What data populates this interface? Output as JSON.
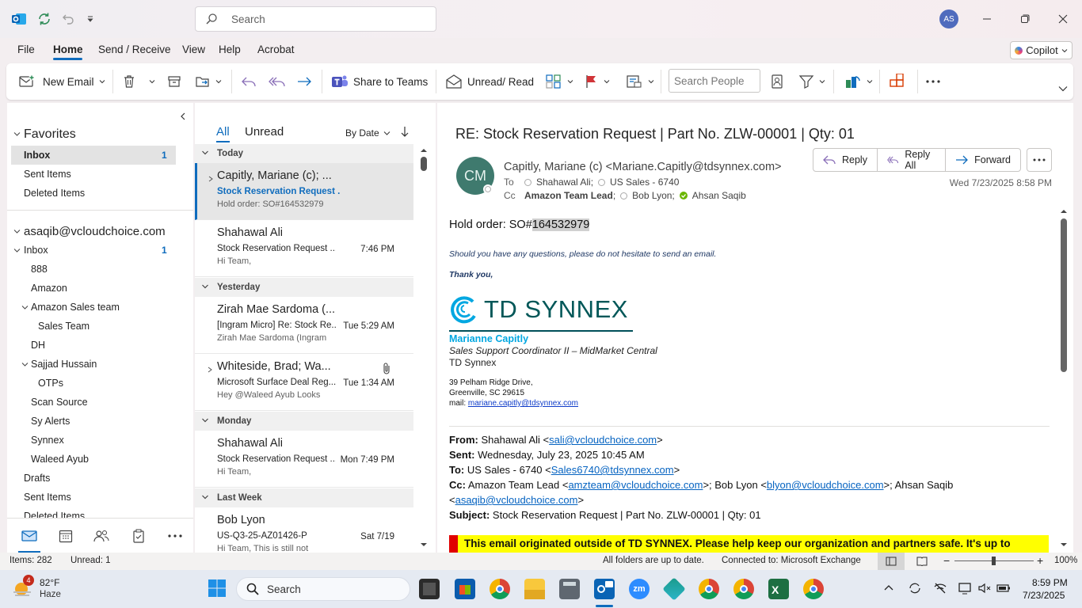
{
  "window": {
    "search_placeholder": "Search",
    "avatar_initials": "AS"
  },
  "menu": {
    "file": "File",
    "home": "Home",
    "send_receive": "Send / Receive",
    "view": "View",
    "help": "Help",
    "acrobat": "Acrobat",
    "copilot": "Copilot"
  },
  "ribbon": {
    "new_email": "New Email",
    "share_to_teams": "Share to Teams",
    "unread_read": "Unread/ Read",
    "search_people_placeholder": "Search People"
  },
  "nav": {
    "favorites": "Favorites",
    "fav_inbox": "Inbox",
    "fav_inbox_count": "1",
    "fav_sent": "Sent Items",
    "fav_deleted": "Deleted Items",
    "account": "asaqib@vcloudchoice.com",
    "inbox": "Inbox",
    "inbox_count": "1",
    "folders": [
      "888",
      "Amazon",
      "Amazon Sales team",
      "Sales Team",
      "DH",
      "Sajjad Hussain",
      "OTPs",
      "Scan Source",
      "Sy Alerts",
      "Synnex",
      "Waleed Ayub",
      "Drafts",
      "Sent Items",
      "Deleted Items"
    ]
  },
  "list": {
    "tab_all": "All",
    "tab_unread": "Unread",
    "sort": "By Date",
    "groups": {
      "today": "Today",
      "yesterday": "Yesterday",
      "monday": "Monday",
      "last_week": "Last Week"
    },
    "messages": [
      {
        "sender": "Capitly, Mariane (c); ...",
        "subject": "Stock Reservation Request ...",
        "time": "",
        "preview": "Hold order: SO#164532979"
      },
      {
        "sender": "Shahawal Ali",
        "subject": "Stock Reservation Request ...",
        "time": "7:46 PM",
        "preview": "Hi Team,"
      },
      {
        "sender": "Zirah Mae Sardoma (...",
        "subject": "[Ingram Micro] Re: Stock Re...",
        "time": "Tue 5:29 AM",
        "preview": "Zirah Mae Sardoma (Ingram"
      },
      {
        "sender": "Whiteside, Brad;  Wa...",
        "subject": "Microsoft Surface Deal Reg...",
        "time": "Tue 1:34 AM",
        "preview": "Hey @Waleed Ayub  Looks"
      },
      {
        "sender": "Shahawal Ali",
        "subject": "Stock Reservation Request ...",
        "time": "Mon 7:49 PM",
        "preview": "Hi Team,"
      },
      {
        "sender": "Bob Lyon",
        "subject": "US-Q3-25-AZ01426-P",
        "time": "Sat 7/19",
        "preview": "Hi Team,  This is still not"
      }
    ]
  },
  "email": {
    "subject": "RE: Stock Reservation Request | Part No. ZLW-00001 | Qty: 01",
    "sender_initials": "CM",
    "from": "Capitly, Mariane (c) <Mariane.Capitly@tdsynnex.com>",
    "to_label": "To",
    "to": [
      "Shahawal Ali;",
      "US Sales - 6740"
    ],
    "cc_label": "Cc",
    "cc": [
      "Amazon Team Lead",
      "; ",
      "Bob Lyon;",
      "Ahsan Saqib"
    ],
    "date": "Wed 7/23/2025 8:58 PM",
    "reply": "Reply",
    "reply_all": "Reply All",
    "forward": "Forward",
    "body_hold_prefix": "Hold order: SO#",
    "body_hold_number": "164532979",
    "body_questions": "Should you have any questions, please do not hesitate to send an email.",
    "body_thanks": "Thank you,",
    "logo_text": "TD SYNNEX",
    "sig_name": "Marianne Capitly",
    "sig_title": "Sales Support Coordinator II – MidMarket Central",
    "sig_company": "TD Synnex",
    "sig_addr1": "39 Pelham Ridge Drive,",
    "sig_addr2": "Greenville, SC 29615",
    "sig_mail_label": "mail: ",
    "sig_mail": "mariane.capitly@tdsynnex.com",
    "q_from_label": "From:",
    "q_from_name": " Shahawal Ali <",
    "q_from_mail": "sali@vcloudchoice.com",
    "q_sent_label": "Sent:",
    "q_sent": " Wednesday, July 23, 2025 10:45 AM",
    "q_to_label": "To:",
    "q_to_name": " US Sales - 6740 <",
    "q_to_mail": "Sales6740@tdsynnex.com",
    "q_cc_label": "Cc:",
    "q_cc_name1": " Amazon Team Lead <",
    "q_cc_mail1": "amzteam@vcloudchoice.com",
    "q_cc_name2": ">; Bob Lyon <",
    "q_cc_mail2": "blyon@vcloudchoice.com",
    "q_cc_name3": ">; Ahsan Saqib",
    "q_cc_mail3": "asaqib@vcloudchoice.com",
    "q_subject_label": "Subject:",
    "q_subject": " Stock Reservation Request | Part No. ZLW-00001 | Qty: 01",
    "banner": "This email originated outside of TD SYNNEX.  Please help keep our organization and partners safe. It's up to"
  },
  "status": {
    "items": "Items: 282",
    "unread": "Unread: 1",
    "sync": "All folders are up to date.",
    "connected": "Connected to: Microsoft Exchange",
    "zoom": "100%"
  },
  "taskbar": {
    "weather_badge": "4",
    "temp": "82°F",
    "condition": "Haze",
    "search": "Search",
    "time": "8:59 PM",
    "date": "7/23/2025"
  },
  "colors": {
    "accent": "#0f6cbd",
    "sender_avatar": "#3f7a6e",
    "td_cyan": "#00a7e1",
    "banner_yellow": "#ffff00",
    "banner_red": "#e00000"
  }
}
